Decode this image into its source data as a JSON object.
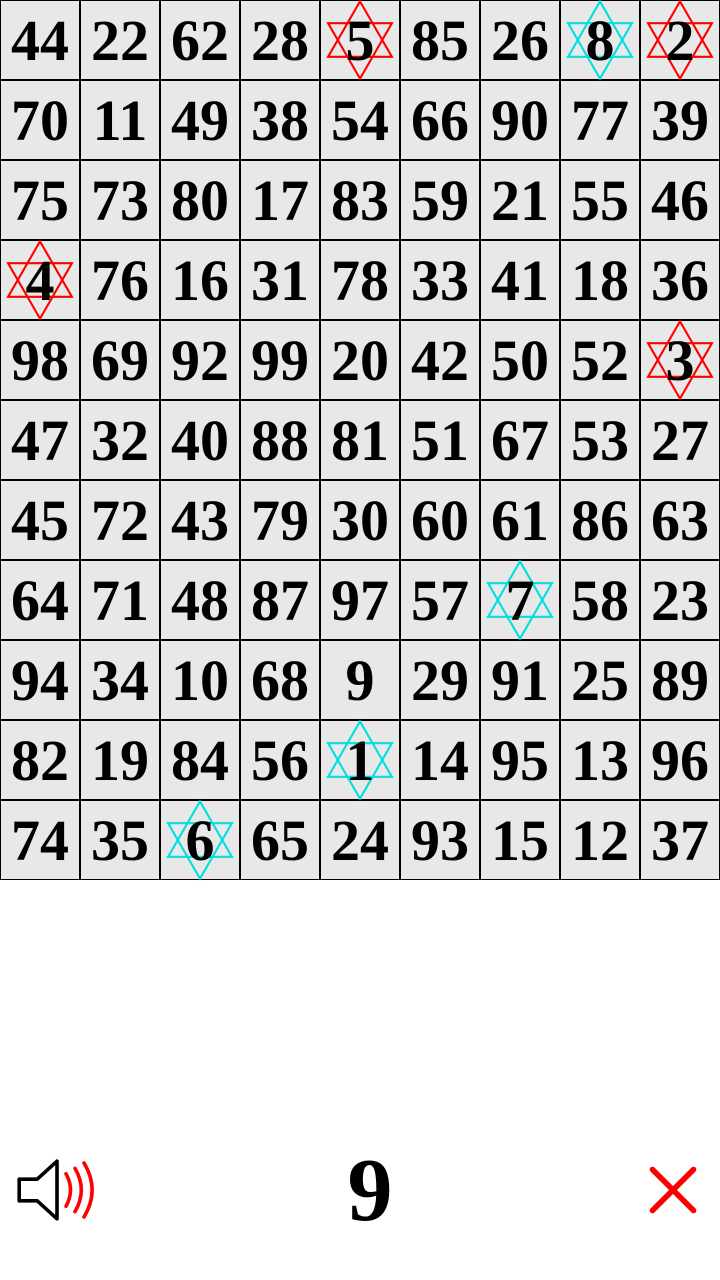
{
  "grid": {
    "cols": 9,
    "rows": 11,
    "cells": [
      {
        "n": 44
      },
      {
        "n": 22
      },
      {
        "n": 62
      },
      {
        "n": 28
      },
      {
        "n": 5,
        "star": "red"
      },
      {
        "n": 85
      },
      {
        "n": 26
      },
      {
        "n": 8,
        "star": "cyan"
      },
      {
        "n": 2,
        "star": "red"
      },
      {
        "n": 70
      },
      {
        "n": 11
      },
      {
        "n": 49
      },
      {
        "n": 38
      },
      {
        "n": 54
      },
      {
        "n": 66
      },
      {
        "n": 90
      },
      {
        "n": 77
      },
      {
        "n": 39
      },
      {
        "n": 75
      },
      {
        "n": 73
      },
      {
        "n": 80
      },
      {
        "n": 17
      },
      {
        "n": 83
      },
      {
        "n": 59
      },
      {
        "n": 21
      },
      {
        "n": 55
      },
      {
        "n": 46
      },
      {
        "n": 4,
        "star": "red"
      },
      {
        "n": 76
      },
      {
        "n": 16
      },
      {
        "n": 31
      },
      {
        "n": 78
      },
      {
        "n": 33
      },
      {
        "n": 41
      },
      {
        "n": 18
      },
      {
        "n": 36
      },
      {
        "n": 98
      },
      {
        "n": 69
      },
      {
        "n": 92
      },
      {
        "n": 99
      },
      {
        "n": 20
      },
      {
        "n": 42
      },
      {
        "n": 50
      },
      {
        "n": 52
      },
      {
        "n": 3,
        "star": "red"
      },
      {
        "n": 47
      },
      {
        "n": 32
      },
      {
        "n": 40
      },
      {
        "n": 88
      },
      {
        "n": 81
      },
      {
        "n": 51
      },
      {
        "n": 67
      },
      {
        "n": 53
      },
      {
        "n": 27
      },
      {
        "n": 45
      },
      {
        "n": 72
      },
      {
        "n": 43
      },
      {
        "n": 79
      },
      {
        "n": 30
      },
      {
        "n": 60
      },
      {
        "n": 61
      },
      {
        "n": 86
      },
      {
        "n": 63
      },
      {
        "n": 64
      },
      {
        "n": 71
      },
      {
        "n": 48
      },
      {
        "n": 87
      },
      {
        "n": 97
      },
      {
        "n": 57
      },
      {
        "n": 7,
        "star": "cyan"
      },
      {
        "n": 58
      },
      {
        "n": 23
      },
      {
        "n": 94
      },
      {
        "n": 34
      },
      {
        "n": 10
      },
      {
        "n": 68
      },
      {
        "n": 9
      },
      {
        "n": 29
      },
      {
        "n": 91
      },
      {
        "n": 25
      },
      {
        "n": 89
      },
      {
        "n": 82
      },
      {
        "n": 19
      },
      {
        "n": 84
      },
      {
        "n": 56
      },
      {
        "n": 1,
        "star": "cyan"
      },
      {
        "n": 14
      },
      {
        "n": 95
      },
      {
        "n": 13
      },
      {
        "n": 96
      },
      {
        "n": 74
      },
      {
        "n": 35
      },
      {
        "n": 6,
        "star": "cyan"
      },
      {
        "n": 65
      },
      {
        "n": 24
      },
      {
        "n": 93
      },
      {
        "n": 15
      },
      {
        "n": 12
      },
      {
        "n": 37
      }
    ]
  },
  "target_number": 9,
  "colors": {
    "red_star": "#ff0000",
    "cyan_star": "#00e0e0",
    "close_x": "#ff0000",
    "sound_waves": "#ff0000"
  },
  "icons": {
    "sound": "sound-icon",
    "close": "close-icon"
  }
}
